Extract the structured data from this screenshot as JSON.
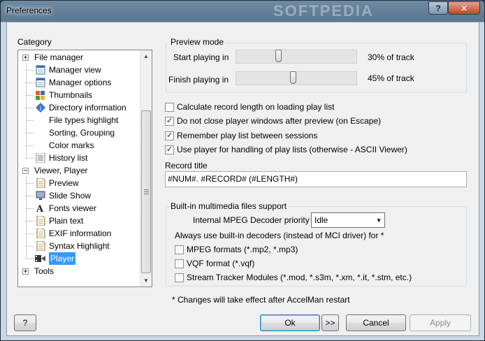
{
  "window": {
    "title": "Preferences",
    "help_glyph": "?",
    "close_glyph": "✕",
    "watermark": "SOFTPEDIA"
  },
  "category": {
    "label": "Category",
    "items": [
      {
        "label": "File manager",
        "expander": "+",
        "icon": "none-icon"
      },
      {
        "label": "Manager view",
        "icon": "window-icon"
      },
      {
        "label": "Manager options",
        "icon": "window-icon"
      },
      {
        "label": "Thumbnails",
        "icon": "thumbnails-icon"
      },
      {
        "label": "Directory information",
        "icon": "info-icon"
      },
      {
        "label": "File types highlight",
        "icon": "none-icon"
      },
      {
        "label": "Sorting, Grouping",
        "icon": "none-icon"
      },
      {
        "label": "Color marks",
        "icon": "none-icon"
      },
      {
        "label": "History list",
        "icon": "list-icon"
      },
      {
        "label": "Viewer, Player",
        "expander": "−",
        "icon": "none-icon"
      },
      {
        "label": "Preview",
        "icon": "document-icon"
      },
      {
        "label": "Slide Show",
        "icon": "monitor-icon"
      },
      {
        "label": "Fonts viewer",
        "icon": "font-icon"
      },
      {
        "label": "Plain text",
        "icon": "document-icon"
      },
      {
        "label": "EXIF information",
        "icon": "document-icon"
      },
      {
        "label": "Syntax Highlight",
        "icon": "document-icon"
      },
      {
        "label": "Player",
        "icon": "film-icon",
        "selected": true
      },
      {
        "label": "Tools",
        "expander": "+",
        "icon": "none-icon"
      }
    ]
  },
  "preview_mode": {
    "title": "Preview mode",
    "start_label": "Start playing in",
    "start_value": "30% of track",
    "start_fraction": 0.3,
    "finish_label": "Finish playing in",
    "finish_value": "45% of track",
    "finish_fraction": 0.45
  },
  "options": [
    {
      "label": "Calculate record length on loading play list",
      "checked": false
    },
    {
      "label": "Do not close player windows after preview (on Escape)",
      "checked": true
    },
    {
      "label": "Remember play list between sessions",
      "checked": true
    },
    {
      "label": "Use player for handling of play lists (otherwise - ASCII Viewer)",
      "checked": true
    }
  ],
  "record_title": {
    "label": "Record title",
    "value": "#NUM#. #RECORD# (#LENGTH#)"
  },
  "multimedia": {
    "title": "Built-in multimedia files support",
    "mpeg_priority_label": "Internal MPEG Decoder priority",
    "mpeg_priority_value": "Idle",
    "decoders_label": "Always use built-in decoders (instead of MCI driver) for *",
    "decoders": [
      {
        "label": "MPEG formats (*.mp2, *.mp3)",
        "checked": false
      },
      {
        "label": "VQF format (*.vqf)",
        "checked": false
      },
      {
        "label": "Stream Tracker Modules (*.mod, *.s3m, *.xm, *.it, *.stm, etc.)",
        "checked": false
      }
    ]
  },
  "restart_note": "* Changes will take effect after AccelMan restart",
  "buttons": {
    "help": "?",
    "ok": "Ok",
    "next": ">>",
    "cancel": "Cancel",
    "apply": "Apply"
  },
  "check_glyph": "✓"
}
